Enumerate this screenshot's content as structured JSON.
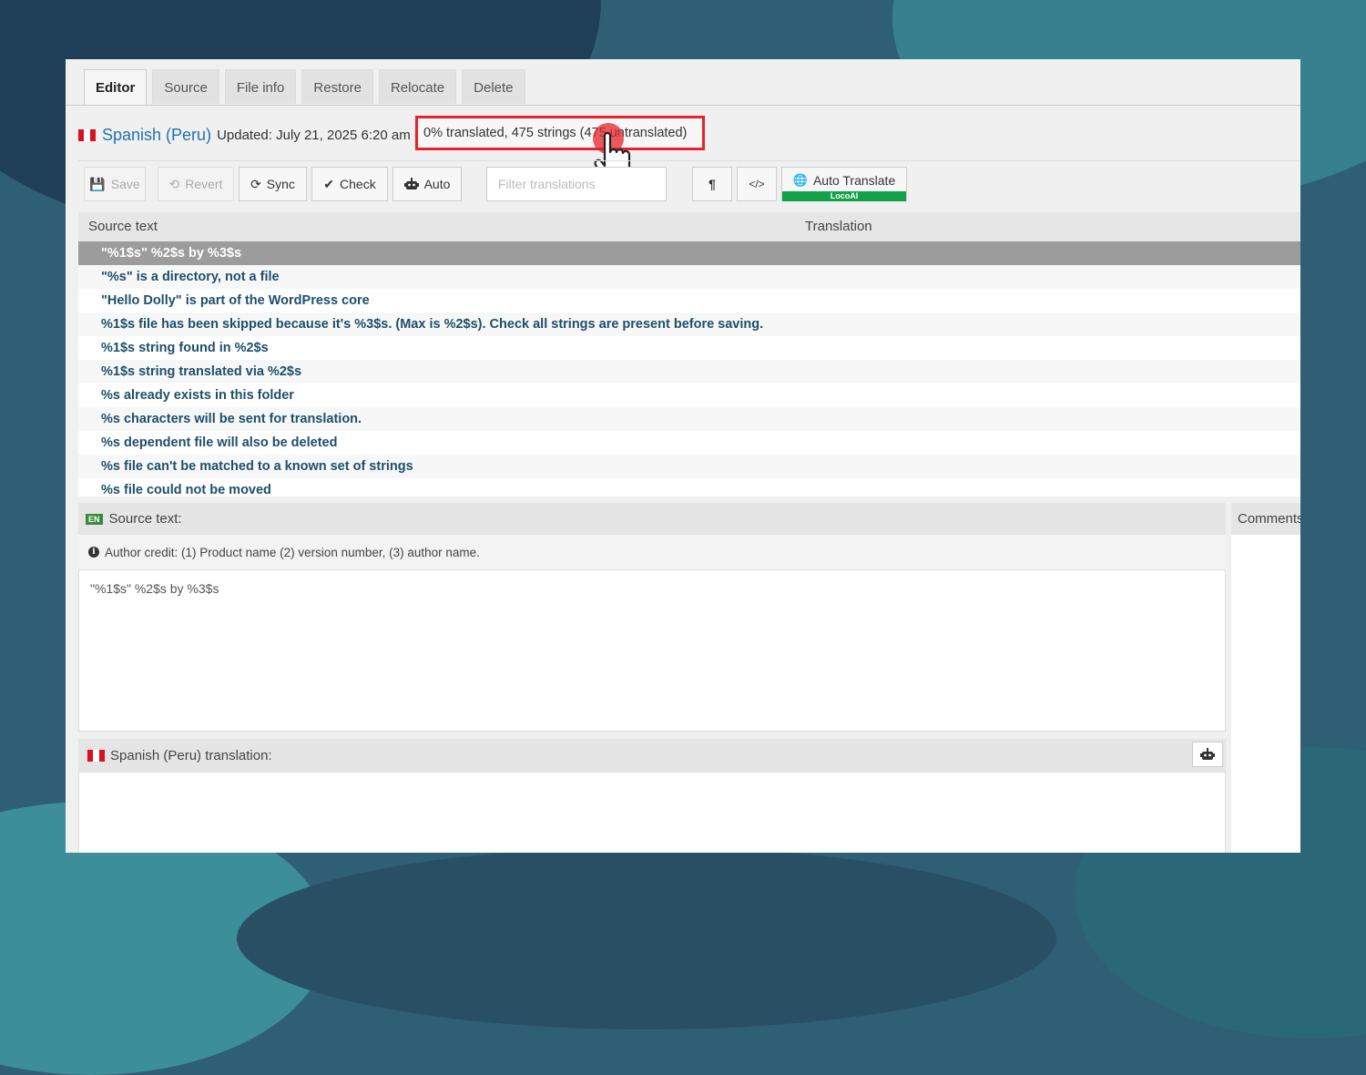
{
  "tabs": [
    {
      "label": "Editor",
      "active": true
    },
    {
      "label": "Source"
    },
    {
      "label": "File info"
    },
    {
      "label": "Restore"
    },
    {
      "label": "Relocate"
    },
    {
      "label": "Delete"
    }
  ],
  "header": {
    "language": "Spanish (Peru)",
    "updated": "Updated: July 21, 2025 6:20 am -",
    "stats": "0% translated, 475 strings (475 untranslated)"
  },
  "toolbar": {
    "save": "Save",
    "revert": "Revert",
    "sync": "Sync",
    "check": "Check",
    "auto": "Auto",
    "filter_placeholder": "Filter translations",
    "pilcrow": "¶",
    "code": "</>",
    "auto_translate": "Auto Translate",
    "auto_translate_badge": "LocoAI"
  },
  "list": {
    "col_source": "Source text",
    "col_translation": "Translation",
    "rows": [
      "\"%1$s\" %2$s by %3$s",
      "\"%s\" is a directory, not a file",
      "\"Hello Dolly\" is part of the WordPress core",
      "%1$s file has been skipped because it's %3$s. (Max is %2$s). Check all strings are present before saving.",
      "%1$s string found in %2$s",
      "%1$s string translated via %2$s",
      "%s already exists in this folder",
      "%s characters will be sent for translation.",
      "%s dependent file will also be deleted",
      "%s file can't be matched to a known set of strings",
      "%s file could not be moved"
    ]
  },
  "source_panel": {
    "badge": "EN",
    "title": "Source text:",
    "note": "Author credit: (1) Product name (2) version number, (3) author name.",
    "text": "\"%1$s\" %2$s by %3$s"
  },
  "comments_title": "Comments",
  "translation_panel": {
    "title": "Spanish (Peru) translation:"
  },
  "colors": {
    "accent": "#2271b1",
    "highlight_box": "#e4232c",
    "locoai_green": "#12a34a",
    "row_text": "#1d4f6b"
  }
}
